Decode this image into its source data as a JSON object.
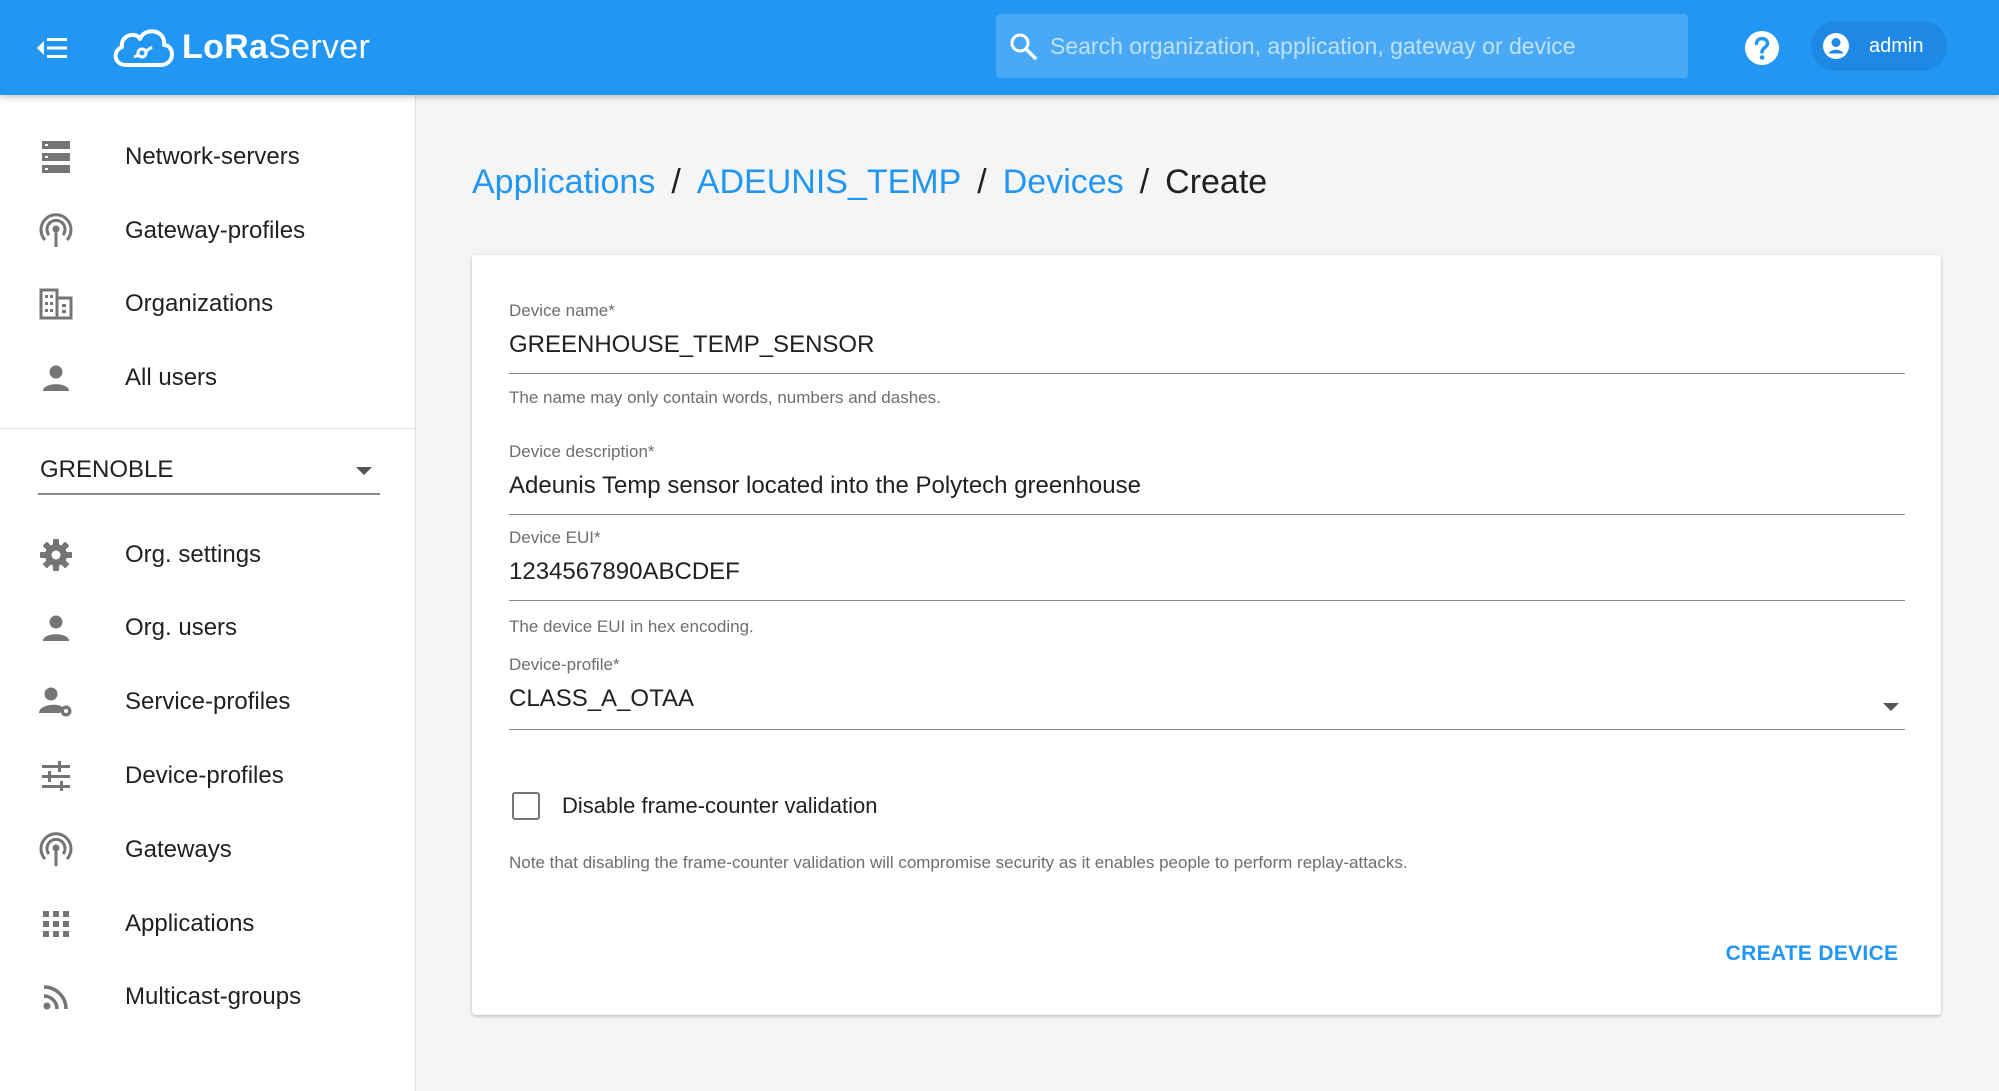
{
  "app": {
    "logo_text_bold": "LoRa",
    "logo_text_rest": "Server",
    "search_placeholder": "Search organization, application, gateway or device",
    "user_name": "admin"
  },
  "colors": {
    "primary": "#2196f3",
    "chip": "#1e88e5"
  },
  "sidebar": {
    "global_items": [
      {
        "label": "Network-servers",
        "icon": "server-icon"
      },
      {
        "label": "Gateway-profiles",
        "icon": "antenna-icon"
      },
      {
        "label": "Organizations",
        "icon": "building-icon"
      },
      {
        "label": "All users",
        "icon": "person-icon"
      }
    ],
    "org_selected": "GRENOBLE",
    "org_items": [
      {
        "label": "Org. settings",
        "icon": "gear-icon"
      },
      {
        "label": "Org. users",
        "icon": "person-icon"
      },
      {
        "label": "Service-profiles",
        "icon": "person-settings-icon"
      },
      {
        "label": "Device-profiles",
        "icon": "tune-icon"
      },
      {
        "label": "Gateways",
        "icon": "antenna-icon"
      },
      {
        "label": "Applications",
        "icon": "apps-grid-icon"
      },
      {
        "label": "Multicast-groups",
        "icon": "rss-icon"
      }
    ]
  },
  "breadcrumb": {
    "applications": "Applications",
    "app_name": "ADEUNIS_TEMP",
    "devices": "Devices",
    "current": "Create",
    "separator": "/"
  },
  "form": {
    "name_label": "Device name",
    "name_value": "GREENHOUSE_TEMP_SENSOR",
    "name_helper": "The name may only contain words, numbers and dashes.",
    "description_label": "Device description",
    "description_value": "Adeunis Temp sensor located into the Polytech greenhouse",
    "eui_label": "Device EUI",
    "eui_value": "1234567890ABCDEF",
    "eui_helper": "The device EUI in hex encoding.",
    "profile_label": "Device-profile",
    "profile_value": "CLASS_A_OTAA",
    "required_mark": "*",
    "checkbox_label": "Disable frame-counter validation",
    "checkbox_checked": false,
    "checkbox_note": "Note that disabling the frame-counter validation will compromise security as it enables people to perform replay-attacks.",
    "submit_label": "CREATE DEVICE"
  }
}
